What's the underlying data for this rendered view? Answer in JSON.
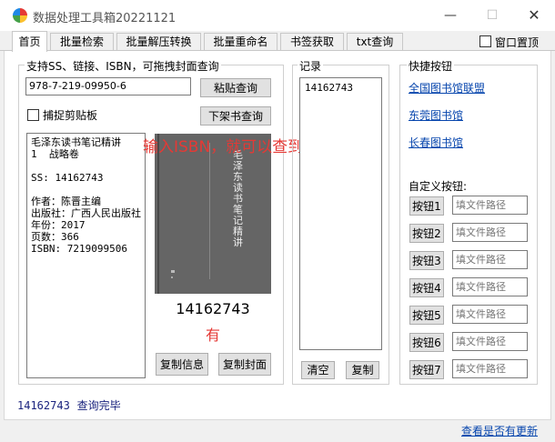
{
  "app": {
    "title": "数据处理工具箱20221121",
    "min_glyph": "—",
    "max_glyph": "☐",
    "close_glyph": "✕"
  },
  "tabs": [
    {
      "label": "首页",
      "active": true
    },
    {
      "label": "批量检索",
      "active": false
    },
    {
      "label": "批量解压转换",
      "active": false
    },
    {
      "label": "批量重命名",
      "active": false
    },
    {
      "label": "书签获取",
      "active": false
    },
    {
      "label": "txt查询",
      "active": false
    }
  ],
  "window_topmost": {
    "label": "窗口置顶",
    "checked": false
  },
  "search_group": {
    "title": "支持SS、链接、ISBN，可拖拽封面查询",
    "input_value": "978-7-219-09950-6",
    "paste_button": "粘贴查询",
    "capture_clipboard_label": "捕捉剪贴板",
    "capture_clipboard_checked": false,
    "offshelf_button": "下架书查询",
    "hint_text": "输入ISBN，就可以查到SS号",
    "hint_color": "#e53935",
    "info_lines": [
      "毛泽东读书笔记精讲",
      "1  战略卷",
      "",
      "SS: 14162743",
      "",
      "作者：陈晋主编",
      "出版社：广西人民出版社",
      "年份：2017",
      "页数：366",
      "ISBN: 7219099506"
    ],
    "cover_title_text": "毛泽东读书笔记精讲",
    "ss_number": "14162743",
    "status_found": "有",
    "copy_info_button": "复制信息",
    "copy_cover_button": "复制封面"
  },
  "records_group": {
    "title": "记录",
    "items": [
      "14162743"
    ],
    "clear_button": "清空",
    "copy_button": "复制"
  },
  "quick_group": {
    "title": "快捷按钮",
    "links": [
      "全国图书馆联盟",
      "东莞图书馆",
      "长春图书馆"
    ],
    "custom_title": "自定义按钮:",
    "custom_buttons": [
      {
        "label": "按钮1",
        "placeholder": "填文件路径"
      },
      {
        "label": "按钮2",
        "placeholder": "填文件路径"
      },
      {
        "label": "按钮3",
        "placeholder": "填文件路径"
      },
      {
        "label": "按钮4",
        "placeholder": "填文件路径"
      },
      {
        "label": "按钮5",
        "placeholder": "填文件路径"
      },
      {
        "label": "按钮6",
        "placeholder": "填文件路径"
      },
      {
        "label": "按钮7",
        "placeholder": "填文件路径"
      }
    ]
  },
  "status": {
    "ss": "14162743",
    "message": "查询完毕",
    "update_link": "查看是否有更新"
  }
}
